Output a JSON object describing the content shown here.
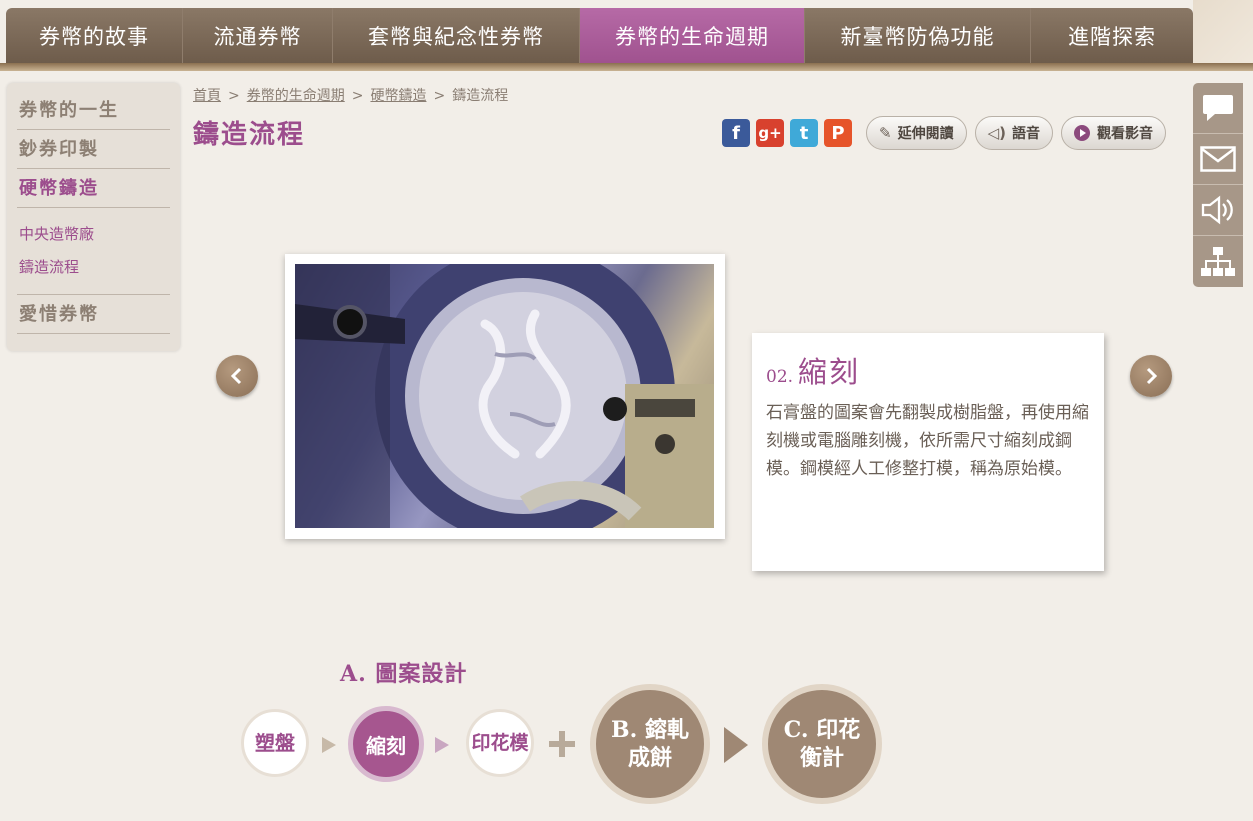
{
  "nav": {
    "tabs": [
      {
        "label": "券幣的故事",
        "active": false
      },
      {
        "label": "流通券幣",
        "active": false
      },
      {
        "label": "套幣與紀念性券幣",
        "active": false
      },
      {
        "label": "券幣的生命週期",
        "active": true
      },
      {
        "label": "新臺幣防偽功能",
        "active": false
      },
      {
        "label": "進階探索",
        "active": false
      }
    ]
  },
  "sidebar": {
    "items": [
      {
        "label": "券幣的一生"
      },
      {
        "label": "鈔券印製"
      },
      {
        "label": "硬幣鑄造"
      },
      {
        "label": "愛惜券幣"
      }
    ],
    "subitems": [
      {
        "label": "中央造幣廠"
      },
      {
        "label": "鑄造流程"
      }
    ]
  },
  "breadcrumb": {
    "home": "首頁",
    "level1": "券幣的生命週期",
    "level2": "硬幣鑄造",
    "current": "鑄造流程",
    "separator": ">"
  },
  "page": {
    "title": "鑄造流程"
  },
  "tools": {
    "facebook": "f",
    "googleplus": "g+",
    "twitter": "t",
    "plurk": "P",
    "extended_reading": "延伸閱讀",
    "voice": "語音",
    "watch_video": "觀看影音"
  },
  "slide": {
    "number": "02.",
    "title": "縮刻",
    "description": "石膏盤的圖案會先翻製成樹脂盤，再使用縮刻機或電腦雕刻機，依所需尺寸縮刻成鋼模。鋼模經人工修整打模，稱為原始模。"
  },
  "process": {
    "stage_a_label": "A. 圖案設計",
    "steps": [
      "塑盤",
      "縮刻",
      "印花模"
    ],
    "stage_b": "B. 鎔軋\n成餅",
    "stage_c": "C. 印花\n衡計"
  },
  "colors": {
    "accent": "#9c4d8d",
    "nav_bg": "#7a6856",
    "step_brown": "#9f8874"
  }
}
